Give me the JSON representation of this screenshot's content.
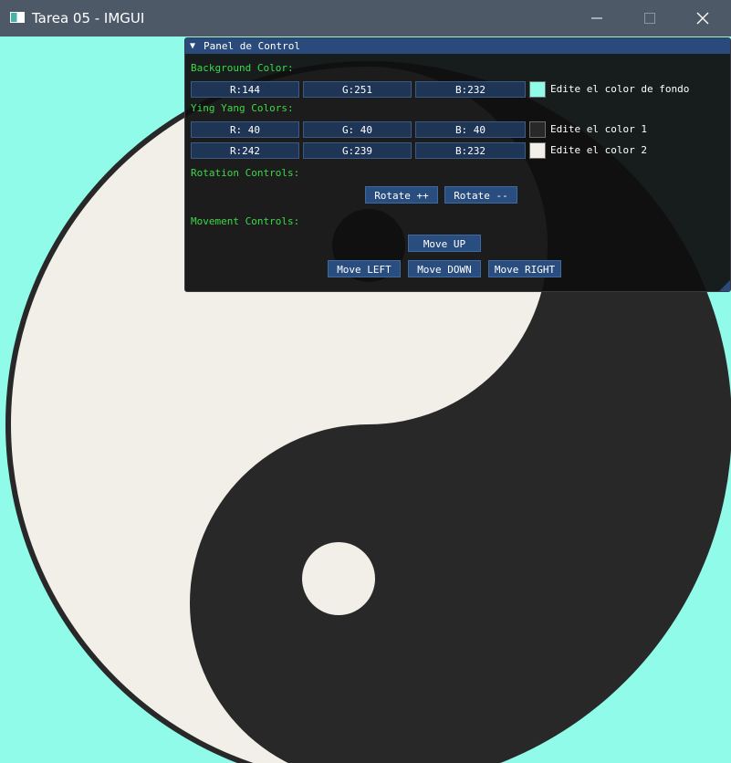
{
  "window": {
    "title": "Tarea 05 - IMGUI",
    "icon": "app-window-icon",
    "controls": [
      "minimize-icon",
      "maximize-icon",
      "close-icon"
    ]
  },
  "colors": {
    "background": "#90fbe8",
    "yin": "#282828",
    "yang": "#f2efe8",
    "label_green": "#3bd94a"
  },
  "panel": {
    "title": "Panel de Control",
    "background_label": "Background Color:",
    "background": {
      "r": "R:144",
      "g": "G:251",
      "b": "B:232",
      "desc": "Edite el color de fondo",
      "swatch": "#90fbe8"
    },
    "yy_label": "Ying Yang Colors:",
    "color1": {
      "r": "R: 40",
      "g": "G: 40",
      "b": "B: 40",
      "desc": "Edite el color 1",
      "swatch": "#282828"
    },
    "color2": {
      "r": "R:242",
      "g": "G:239",
      "b": "B:232",
      "desc": "Edite el color 2",
      "swatch": "#f2efe8"
    },
    "rotation_label": "Rotation Controls:",
    "rotate_plus": "Rotate ++",
    "rotate_minus": "Rotate --",
    "movement_label": "Movement Controls:",
    "move_up": "Move UP",
    "move_left": "Move LEFT",
    "move_down": "Move DOWN",
    "move_right": "Move RIGHT"
  }
}
